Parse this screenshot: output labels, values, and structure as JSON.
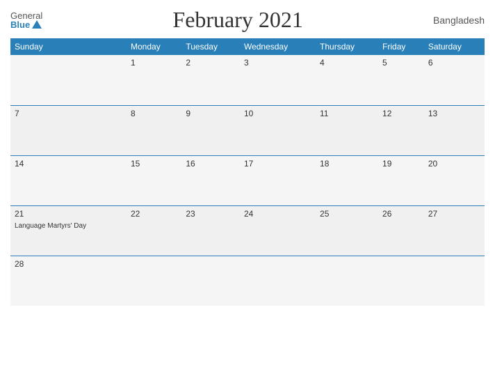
{
  "header": {
    "logo_general": "General",
    "logo_blue": "Blue",
    "title": "February 2021",
    "country": "Bangladesh"
  },
  "weekdays": [
    "Sunday",
    "Monday",
    "Tuesday",
    "Wednesday",
    "Thursday",
    "Friday",
    "Saturday"
  ],
  "weeks": [
    [
      {
        "day": "",
        "event": ""
      },
      {
        "day": "1",
        "event": ""
      },
      {
        "day": "2",
        "event": ""
      },
      {
        "day": "3",
        "event": ""
      },
      {
        "day": "4",
        "event": ""
      },
      {
        "day": "5",
        "event": ""
      },
      {
        "day": "6",
        "event": ""
      }
    ],
    [
      {
        "day": "7",
        "event": ""
      },
      {
        "day": "8",
        "event": ""
      },
      {
        "day": "9",
        "event": ""
      },
      {
        "day": "10",
        "event": ""
      },
      {
        "day": "11",
        "event": ""
      },
      {
        "day": "12",
        "event": ""
      },
      {
        "day": "13",
        "event": ""
      }
    ],
    [
      {
        "day": "14",
        "event": ""
      },
      {
        "day": "15",
        "event": ""
      },
      {
        "day": "16",
        "event": ""
      },
      {
        "day": "17",
        "event": ""
      },
      {
        "day": "18",
        "event": ""
      },
      {
        "day": "19",
        "event": ""
      },
      {
        "day": "20",
        "event": ""
      }
    ],
    [
      {
        "day": "21",
        "event": "Language Martyrs' Day"
      },
      {
        "day": "22",
        "event": ""
      },
      {
        "day": "23",
        "event": ""
      },
      {
        "day": "24",
        "event": ""
      },
      {
        "day": "25",
        "event": ""
      },
      {
        "day": "26",
        "event": ""
      },
      {
        "day": "27",
        "event": ""
      }
    ],
    [
      {
        "day": "28",
        "event": ""
      },
      {
        "day": "",
        "event": ""
      },
      {
        "day": "",
        "event": ""
      },
      {
        "day": "",
        "event": ""
      },
      {
        "day": "",
        "event": ""
      },
      {
        "day": "",
        "event": ""
      },
      {
        "day": "",
        "event": ""
      }
    ]
  ]
}
